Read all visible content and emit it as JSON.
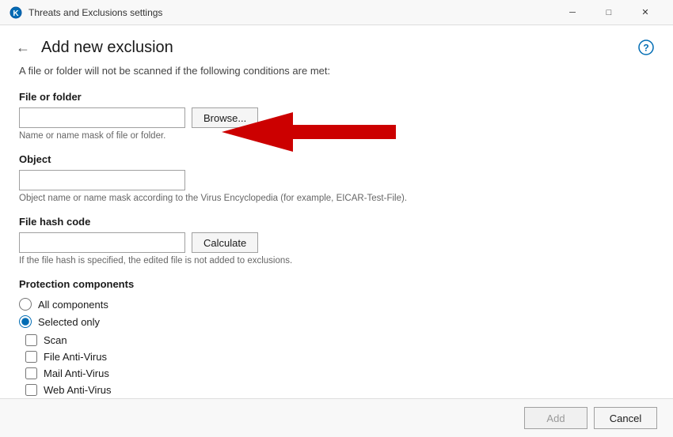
{
  "titleBar": {
    "title": "Threats and Exclusions settings",
    "minimizeLabel": "─",
    "maximizeLabel": "□",
    "closeLabel": "✕"
  },
  "header": {
    "backLabel": "←",
    "pageTitle": "Add new exclusion",
    "helpLabel": "?"
  },
  "subtitle": "A file or folder will not be scanned if the following conditions are met:",
  "fileOrFolder": {
    "label": "File or folder",
    "inputValue": "",
    "inputPlaceholder": "",
    "browseLabel": "Browse...",
    "hint": "Name or name mask of file or folder."
  },
  "object": {
    "label": "Object",
    "inputValue": "",
    "inputPlaceholder": "",
    "hint": "Object name or name mask according to the Virus Encyclopedia (for example, EICAR-Test-File)."
  },
  "fileHashCode": {
    "label": "File hash code",
    "inputValue": "",
    "inputPlaceholder": "",
    "calculateLabel": "Calculate",
    "hint": "If the file hash is specified, the edited file is not added to exclusions."
  },
  "protectionComponents": {
    "sectionTitle": "Protection components",
    "radioOptions": [
      {
        "id": "all",
        "label": "All components",
        "checked": false
      },
      {
        "id": "selected",
        "label": "Selected only",
        "checked": true
      }
    ],
    "checkboxOptions": [
      {
        "id": "scan",
        "label": "Scan",
        "checked": false
      },
      {
        "id": "fileAV",
        "label": "File Anti-Virus",
        "checked": false
      },
      {
        "id": "mailAV",
        "label": "Mail Anti-Virus",
        "checked": false
      },
      {
        "id": "webAV",
        "label": "Web Anti-Virus",
        "checked": false
      }
    ]
  },
  "footer": {
    "addLabel": "Add",
    "cancelLabel": "Cancel"
  }
}
